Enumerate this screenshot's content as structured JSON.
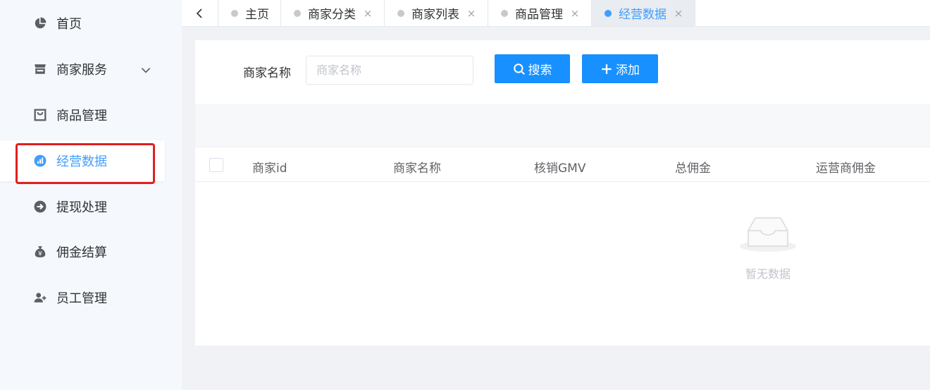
{
  "sidebar": {
    "items": [
      {
        "label": "首页",
        "icon": "pie-chart-icon"
      },
      {
        "label": "商家服务",
        "icon": "store-icon",
        "has_submenu": true
      },
      {
        "label": "商品管理",
        "icon": "shopping-bag-icon"
      },
      {
        "label": "经营数据",
        "icon": "bar-chart-icon",
        "active": true
      },
      {
        "label": "提现处理",
        "icon": "arrow-right-circle-icon"
      },
      {
        "label": "佣金结算",
        "icon": "money-bag-icon"
      },
      {
        "label": "员工管理",
        "icon": "user-add-icon"
      }
    ]
  },
  "tabs": {
    "back_icon": "chevron-left-icon",
    "items": [
      {
        "label": "主页",
        "closable": false
      },
      {
        "label": "商家分类",
        "closable": true
      },
      {
        "label": "商家列表",
        "closable": true
      },
      {
        "label": "商品管理",
        "closable": true
      },
      {
        "label": "经营数据",
        "closable": true,
        "active": true
      }
    ],
    "close_glyph": "×"
  },
  "search": {
    "label": "商家名称",
    "placeholder": "商家名称",
    "value": "",
    "search_button": "搜索",
    "add_button": "添加"
  },
  "table": {
    "columns": [
      "商家id",
      "商家名称",
      "核销GMV",
      "总佣金",
      "运营商佣金"
    ],
    "rows": [],
    "empty_text": "暂无数据"
  },
  "colors": {
    "primary": "#1890ff",
    "active_text": "#409eff",
    "highlight": "#e02020"
  }
}
